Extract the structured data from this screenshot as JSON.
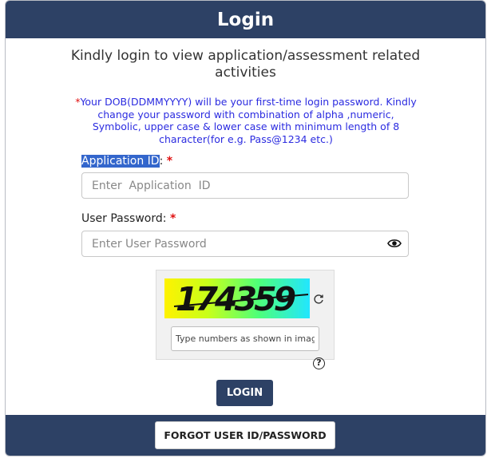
{
  "header": {
    "title": "Login"
  },
  "subtitle": "Kindly login to view application/assessment related activities",
  "notice": {
    "star": "*",
    "text": "Your DOB(DDMMYYYY) will be your first-time login password. Kindly change your password with combination of alpha ,numeric, Symbolic, upper case & lower case with minimum length of 8 character(for e.g. Pass@1234 etc.)"
  },
  "application_id": {
    "label_highlighted": "Application ID",
    "label_suffix": ":",
    "required": "*",
    "placeholder": "Enter  Application  ID",
    "value": ""
  },
  "password": {
    "label": "User Password:",
    "required": "*",
    "placeholder": "Enter User Password",
    "value": "",
    "toggle_icon": "eye-icon"
  },
  "captcha": {
    "code": "174359",
    "refresh_icon": "refresh-icon",
    "placeholder": "Type numbers as shown in image",
    "value": "",
    "help_symbol": "?"
  },
  "buttons": {
    "login": "LOGIN",
    "forgot": "FORGOT USER ID/PASSWORD"
  },
  "colors": {
    "primary": "#2d4165",
    "notice_text": "#2b2be0",
    "required": "#e01010",
    "highlight": "#3366cc"
  }
}
